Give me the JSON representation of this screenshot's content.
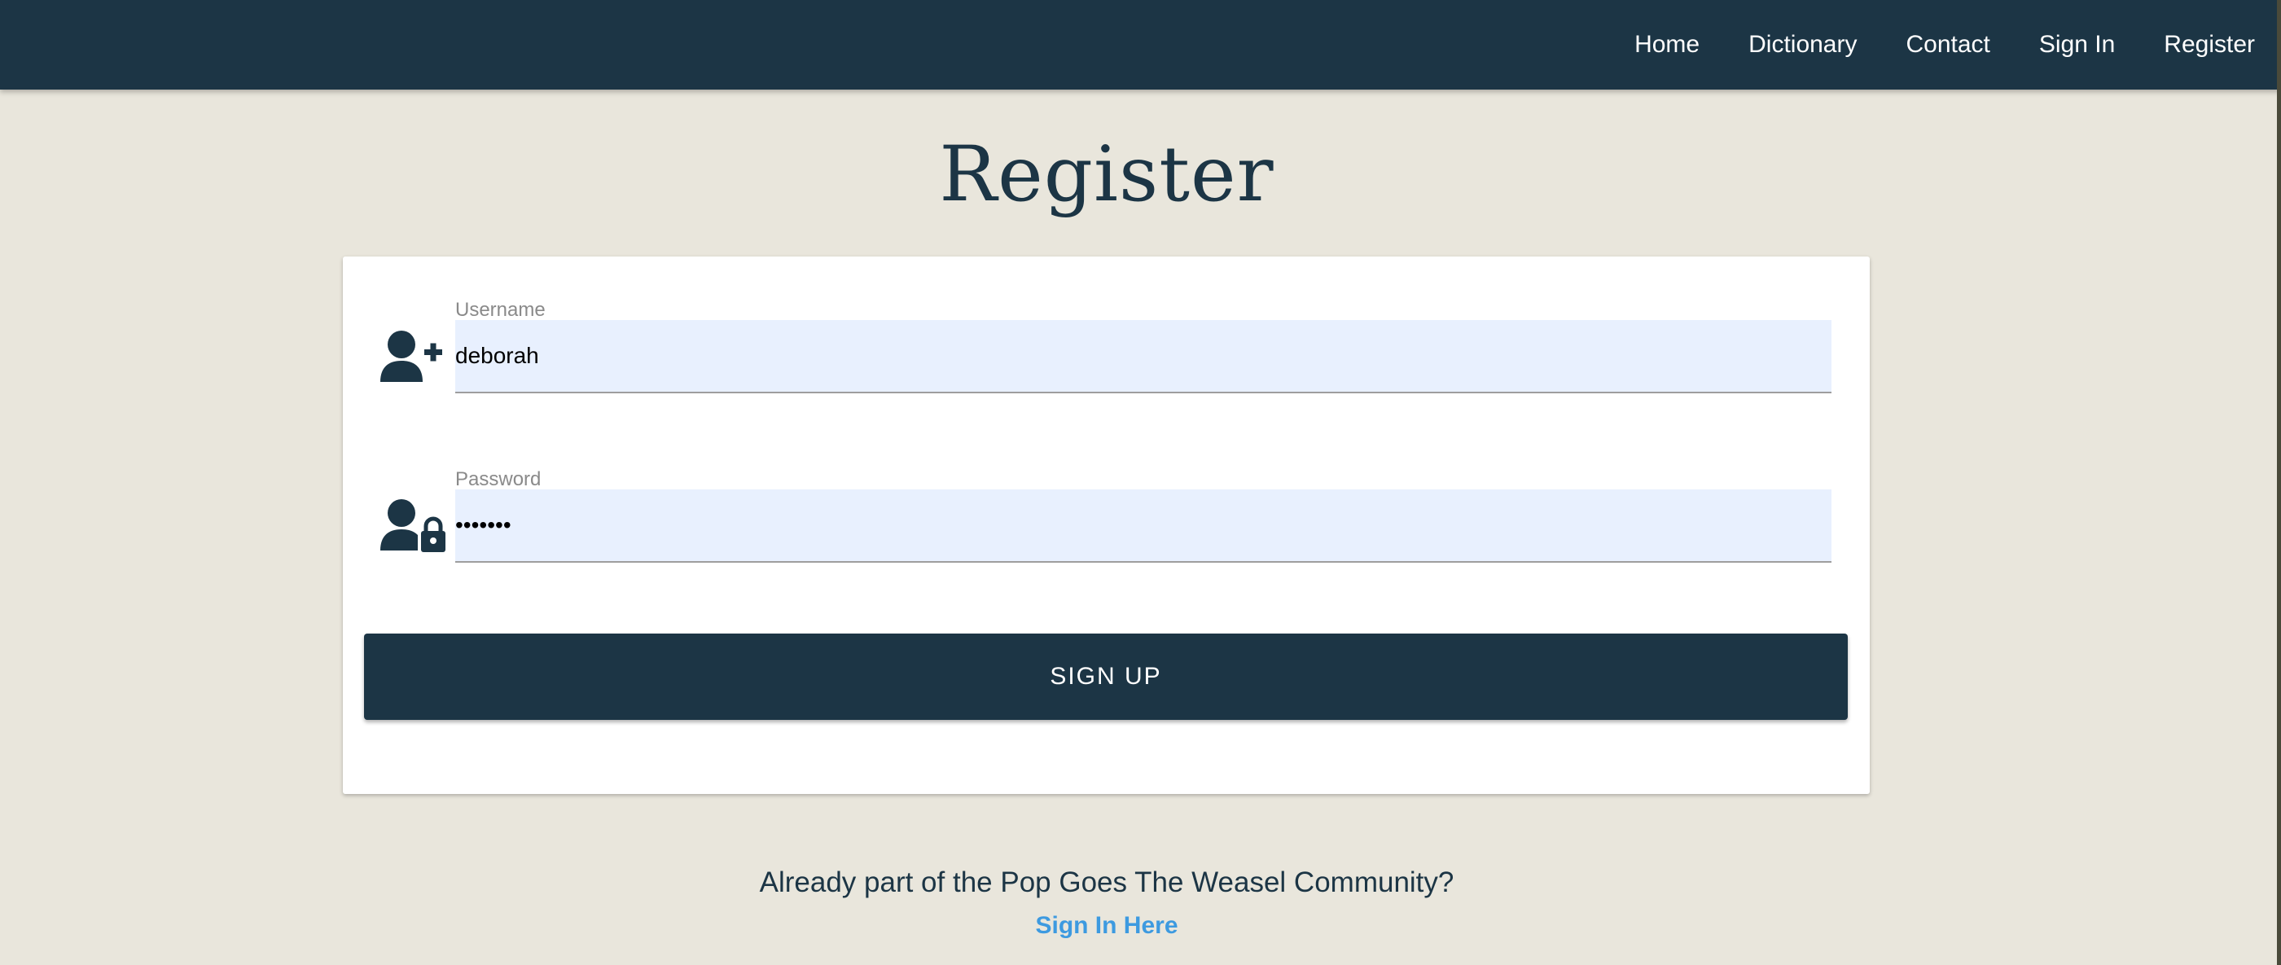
{
  "nav": {
    "items": [
      {
        "label": "Home"
      },
      {
        "label": "Dictionary"
      },
      {
        "label": "Contact"
      },
      {
        "label": "Sign In"
      },
      {
        "label": "Register"
      }
    ]
  },
  "page": {
    "title": "Register"
  },
  "form": {
    "username": {
      "label": "Username",
      "value": "deborah",
      "icon": "user-plus-icon"
    },
    "password": {
      "label": "Password",
      "value": "•••••••",
      "icon": "user-lock-icon"
    },
    "submit_label": "SIGN UP"
  },
  "footer": {
    "prompt": "Already part of the Pop Goes The Weasel Community?",
    "link_label": "Sign In Here"
  },
  "colors": {
    "navbar": "#1c3545",
    "background": "#e9e6dc",
    "input_fill": "#e8f0fe",
    "link": "#3d9ae0"
  }
}
